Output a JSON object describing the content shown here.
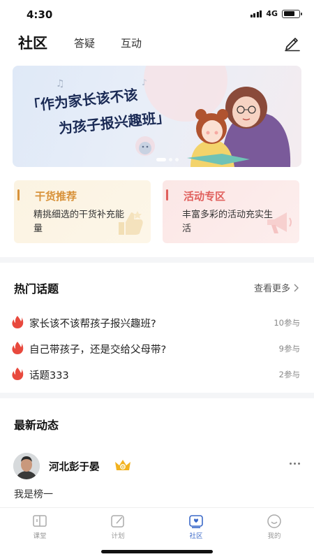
{
  "status_bar": {
    "time": "4:30",
    "network": "4G"
  },
  "top_tabs": [
    "社区",
    "答疑",
    "互动"
  ],
  "banner": {
    "line1": "「作为家长该不该",
    "line2": "为孩子报兴趣班」"
  },
  "cards": [
    {
      "title": "干货推荐",
      "desc": "精挑细选的干货补充能量",
      "accent": "#d8923a"
    },
    {
      "title": "活动专区",
      "desc": "丰富多彩的活动充实生活",
      "accent": "#e05f5c"
    }
  ],
  "hot_topics": {
    "title": "热门话题",
    "see_more": "查看更多",
    "items": [
      {
        "text": "家长该不该帮孩子报兴趣班?",
        "count": "10参与"
      },
      {
        "text": "自己带孩子，还是交给父母带?",
        "count": "9参与"
      },
      {
        "text": "话题333",
        "count": "2参与"
      }
    ]
  },
  "feed": {
    "title": "最新动态",
    "post": {
      "username": "河北彭于晏",
      "level": "0",
      "text": "我是榜一"
    }
  },
  "bottom_nav": [
    {
      "label": "课堂",
      "icon": "book-icon"
    },
    {
      "label": "计划",
      "icon": "edit-note-icon"
    },
    {
      "label": "社区",
      "icon": "community-chat-icon"
    },
    {
      "label": "我的",
      "icon": "smile-profile-icon"
    }
  ],
  "colors": {
    "accent": "#3a68c8",
    "flame": "#e8493d",
    "crown": "#f2b21f"
  }
}
